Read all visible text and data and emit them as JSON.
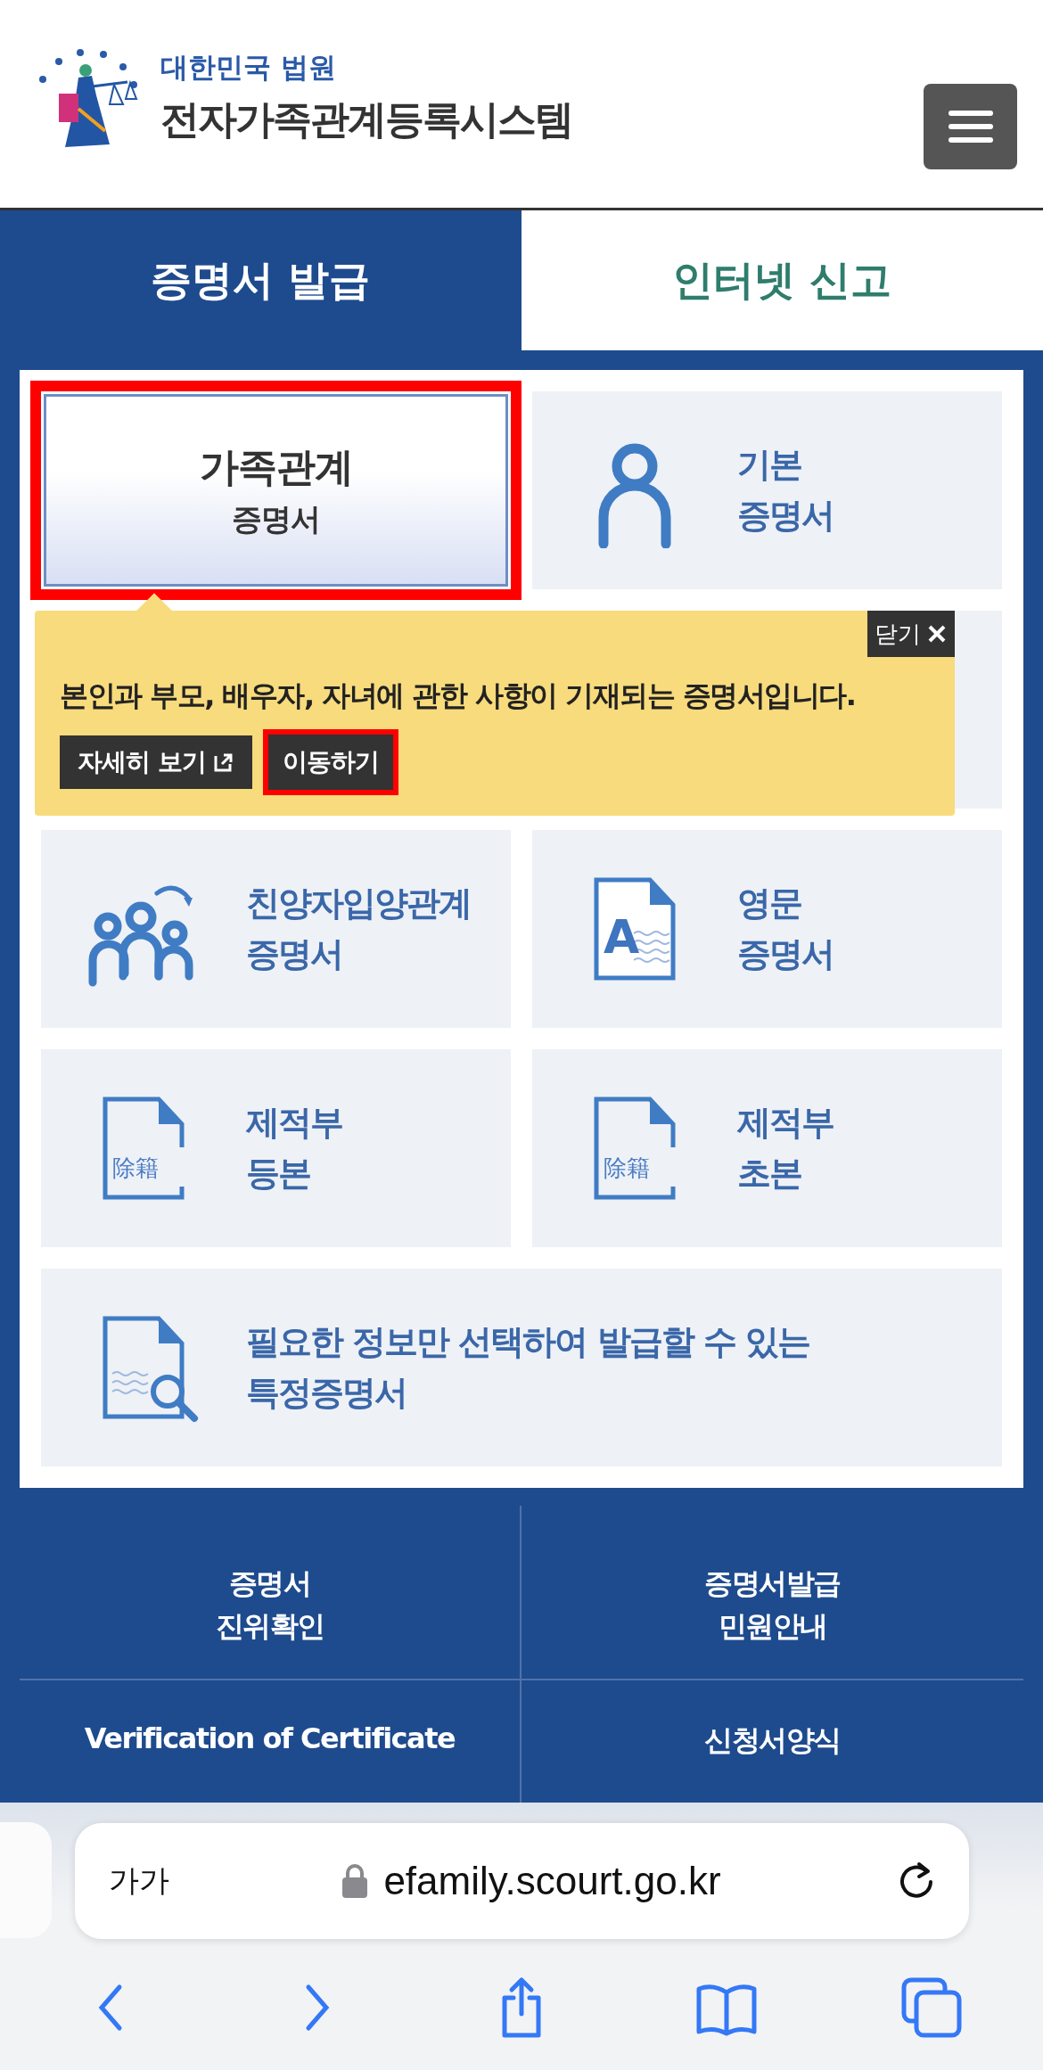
{
  "header": {
    "logo_subtitle": "대한민국 법원",
    "logo_title": "전자가족관계등록시스템"
  },
  "tabs": [
    {
      "label": "증명서 발급",
      "selected": true
    },
    {
      "label": "인터넷 신고",
      "selected": false
    }
  ],
  "tiles": [
    {
      "kind": "featured",
      "lines": [
        "가족관계",
        "증명서"
      ],
      "selected": true,
      "highlighted": true
    },
    {
      "kind": "person",
      "lines": [
        "기본",
        "증명서"
      ],
      "selected": false,
      "highlighted": false
    },
    {
      "kind": "blank"
    },
    {
      "kind": "blank"
    },
    {
      "kind": "family",
      "lines": [
        "친양자입양관계",
        "증명서"
      ],
      "selected": false,
      "highlighted": false
    },
    {
      "kind": "letter-doc",
      "icon_text": "A",
      "lines": [
        "영문",
        "증명서"
      ],
      "selected": false,
      "highlighted": false
    },
    {
      "kind": "stamp-doc",
      "icon_text": "除籍",
      "lines": [
        "제적부",
        "등본"
      ],
      "selected": false,
      "highlighted": false
    },
    {
      "kind": "stamp-doc",
      "icon_text": "除籍",
      "lines": [
        "제적부",
        "초본"
      ],
      "selected": false,
      "highlighted": false
    },
    {
      "kind": "search-doc",
      "wide": true,
      "lines": [
        "필요한 정보만 선택하여 발급할 수 있는",
        "특정증명서"
      ],
      "selected": false,
      "highlighted": false
    }
  ],
  "popup": {
    "close_label": "닫기",
    "text": "본인과 부모, 배우자, 자녀에 관한 사항이 기재되는 증명서입니다.",
    "buttons": [
      {
        "label": "자세히 보기",
        "external": true,
        "highlighted": false
      },
      {
        "label": "이동하기",
        "external": false,
        "highlighted": true
      }
    ]
  },
  "footer_links": [
    {
      "lines": [
        "증명서",
        "진위확인"
      ]
    },
    {
      "lines": [
        "증명서발급",
        "민원안내"
      ]
    },
    {
      "lines": [
        "Verification of Certificate"
      ]
    },
    {
      "lines": [
        "신청서양식"
      ]
    }
  ],
  "browser": {
    "text_size": "가가",
    "url": "efamily.scourt.go.kr"
  }
}
